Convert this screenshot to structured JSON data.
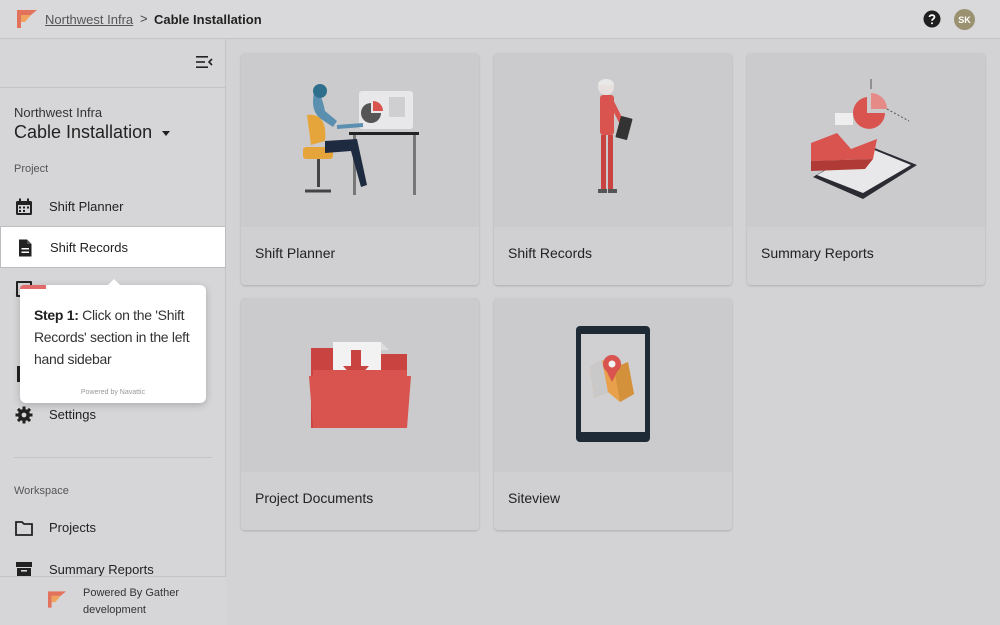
{
  "header": {
    "org_link": "Northwest Infra",
    "separator": ">",
    "current": "Cable Installation",
    "avatar_initials": "SK"
  },
  "sidebar": {
    "org": "Northwest Infra",
    "project": "Cable Installation",
    "project_section": "Project",
    "items": [
      {
        "label": "Shift Planner",
        "icon": "calendar-icon"
      },
      {
        "label": "Shift Records",
        "icon": "document-icon"
      },
      {
        "label": "Settings",
        "icon": "gear-icon"
      }
    ],
    "workspace_section": "Workspace",
    "workspace_items": [
      {
        "label": "Projects",
        "icon": "folder-icon"
      },
      {
        "label": "Summary Reports",
        "icon": "archive-icon"
      }
    ],
    "footer_line1": "Powered By Gather",
    "footer_line2": "development"
  },
  "cards": [
    {
      "title": "Shift Planner"
    },
    {
      "title": "Shift Records"
    },
    {
      "title": "Summary Reports"
    },
    {
      "title": "Project Documents"
    },
    {
      "title": "Siteview"
    }
  ],
  "tooltip": {
    "step": "Step 1:",
    "text": " Click on the 'Shift Records' section in the left hand sidebar",
    "powered": "Powered by Navattic"
  },
  "colors": {
    "accent": "#e36a6a",
    "brand_red": "#d9534f",
    "avatar": "#9a9170"
  }
}
